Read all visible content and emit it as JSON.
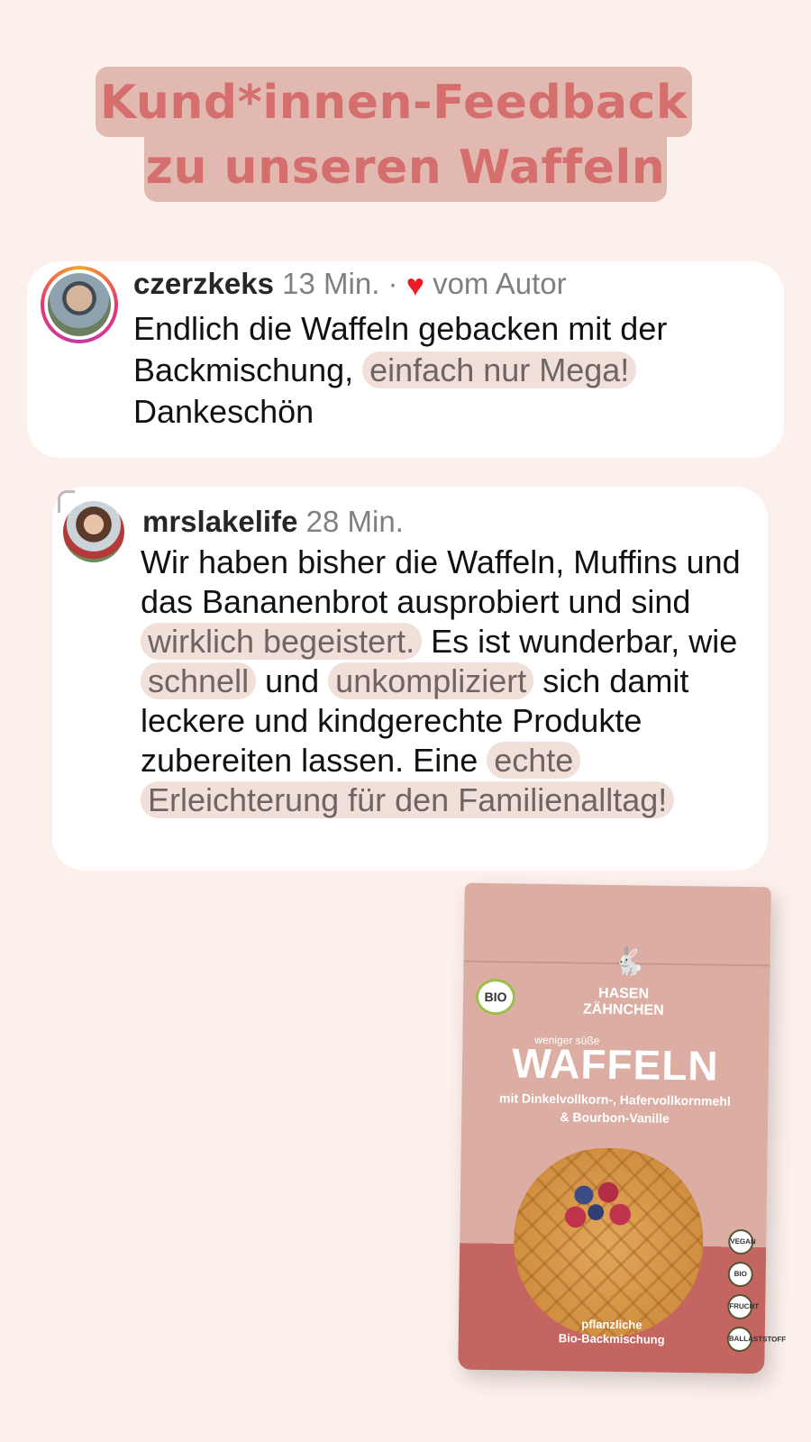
{
  "title": {
    "line1": "Kund*innen-Feedback",
    "line2": "zu unseren Waffeln"
  },
  "comment1": {
    "username": "czerzkeks",
    "time": "13 Min.",
    "separator": "·",
    "liked_by": "vom Autor",
    "avatar_icon": "profile-photo",
    "text_before": "Endlich die Waffeln gebacken mit der Backmischung,",
    "highlight": "einfach nur Mega!",
    "text_after": "Dankeschön"
  },
  "comment2": {
    "username": "mrslakelife",
    "time": "28 Min.",
    "avatar_icon": "profile-photo",
    "t1": "Wir haben bisher die Waffeln, Muffins und das Bananenbrot ausprobiert und sind",
    "h1": "wirklich begeistert.",
    "t2": "Es ist wunderbar, wie",
    "h2": "schnell",
    "t3": "und",
    "h3": "unkompliziert",
    "t4": "sich damit leckere und kindgerechte Produkte zubereiten lassen. Eine",
    "h4": "echte Erleichterung für den Familienalltag!"
  },
  "product": {
    "bio_badge": "BIO",
    "brand_line1": "HASEN",
    "brand_line2": "ZÄHNCHEN",
    "subtitle": "weniger süße",
    "name": "WAFFELN",
    "desc_line1": "mit Dinkelvollkorn-, Hafervollkornmehl",
    "desc_line2": "& Bourbon-Vanille",
    "footer_line1": "pflanzliche",
    "footer_line2": "Bio-Backmischung",
    "side_icons": [
      "VEGAN",
      "BIO",
      "FRUCHT",
      "BALLASTSTOFF"
    ]
  }
}
